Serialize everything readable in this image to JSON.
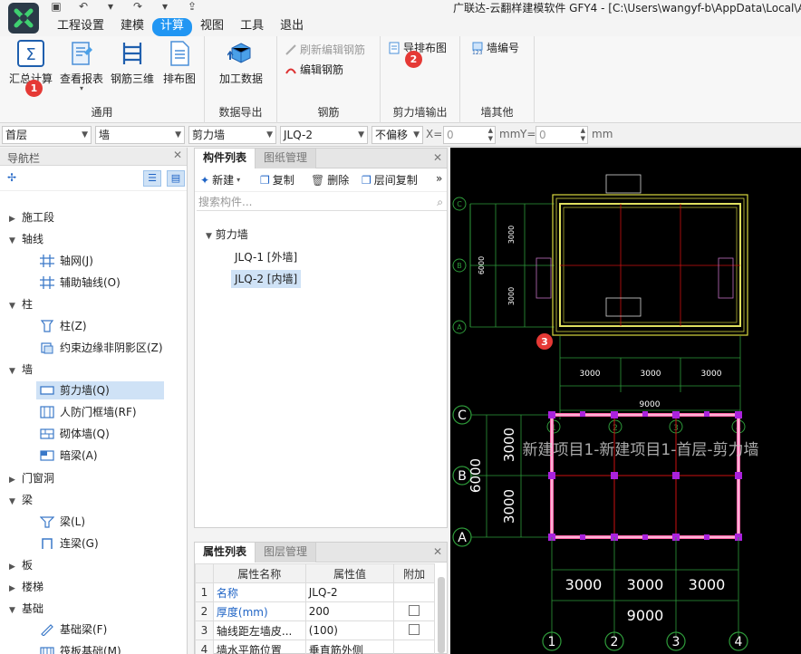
{
  "title_bar": {
    "window_title": "广联达-云翻样建模软件 GFY4 - [C:\\Users\\wangyf-b\\AppData\\Local\\A"
  },
  "menu": {
    "tabs": [
      {
        "label": "工程设置"
      },
      {
        "label": "建模"
      },
      {
        "label": "计算"
      },
      {
        "label": "视图"
      },
      {
        "label": "工具"
      },
      {
        "label": "退出"
      }
    ],
    "active": "计算"
  },
  "ribbon": {
    "groups": {
      "general": {
        "label": "通用",
        "buttons": [
          "汇总计算",
          "查看报表",
          "钢筋三维",
          "排布图"
        ]
      },
      "export": {
        "label": "数据导出",
        "buttons": [
          "加工数据"
        ]
      },
      "rebar": {
        "label": "钢筋",
        "buttons": [
          "刷新编辑钢筋",
          "编辑钢筋"
        ]
      },
      "wall_output": {
        "label": "剪力墙输出",
        "buttons": [
          "导排布图"
        ]
      },
      "wall_other": {
        "label": "墙其他",
        "buttons": [
          "墙编号"
        ]
      }
    },
    "badges": [
      "1",
      "2",
      "3"
    ]
  },
  "selectors": {
    "floor": "首层",
    "category": "墙",
    "type": "剪力墙",
    "component": "JLQ-2",
    "offset": "不偏移",
    "x_label": "X=",
    "x_value": "0",
    "x_unit": "mm",
    "y_label": "Y=",
    "y_value": "0",
    "y_unit": "mm"
  },
  "nav": {
    "title": "导航栏",
    "tree": [
      {
        "label": "施工段",
        "expanded": false
      },
      {
        "label": "轴线",
        "expanded": true,
        "children": [
          "轴网(J)",
          "辅助轴线(O)"
        ]
      },
      {
        "label": "柱",
        "expanded": true,
        "children": [
          "柱(Z)",
          "约束边缘非阴影区(Z)"
        ]
      },
      {
        "label": "墙",
        "expanded": true,
        "children": [
          "剪力墙(Q)",
          "人防门框墙(RF)",
          "砌体墙(Q)",
          "暗梁(A)"
        ]
      },
      {
        "label": "门窗洞",
        "expanded": false
      },
      {
        "label": "梁",
        "expanded": true,
        "children": [
          "梁(L)",
          "连梁(G)"
        ]
      },
      {
        "label": "板",
        "expanded": false
      },
      {
        "label": "楼梯",
        "expanded": false
      },
      {
        "label": "基础",
        "expanded": true,
        "children": [
          "基础梁(F)",
          "筏板基础(M)"
        ]
      }
    ],
    "selected": "剪力墙(Q)"
  },
  "component_panel": {
    "tabs": [
      "构件列表",
      "图纸管理"
    ],
    "toolbar": {
      "new": "新建",
      "copy": "复制",
      "delete": "删除",
      "floor_copy": "层间复制",
      "more": "»"
    },
    "search_placeholder": "搜索构件...",
    "tree_root": "剪力墙",
    "items": [
      "JLQ-1 [外墙]",
      "JLQ-2 [内墙]"
    ],
    "selected": "JLQ-2 [内墙]"
  },
  "property_panel": {
    "tabs": [
      "属性列表",
      "图层管理"
    ],
    "headers": [
      "属性名称",
      "属性值",
      "附加"
    ],
    "rows": [
      {
        "idx": "1",
        "name": "名称",
        "value": "JLQ-2",
        "checkbox": false
      },
      {
        "idx": "2",
        "name": "厚度(mm)",
        "value": "200",
        "checkbox": true
      },
      {
        "idx": "3",
        "name": "轴线距左墙皮...",
        "value": "(100)",
        "checkbox": true
      },
      {
        "idx": "4",
        "name": "墙水平筋位置",
        "value": "垂直筋外侧",
        "checkbox": false
      }
    ]
  },
  "canvas": {
    "overlay_text": "新建项目1-新建项目1-首层-剪力墙",
    "thumbnail": {
      "row_labels": [
        "C",
        "B",
        "A"
      ],
      "dims_h": [
        "3000",
        "3000",
        "3000"
      ],
      "total_h": "9000",
      "dims_v": [
        "3000",
        "3000"
      ],
      "total_v": "6000"
    },
    "plan": {
      "row_labels": [
        "C",
        "B",
        "A"
      ],
      "col_labels_top": [
        "1",
        "2",
        "3",
        "4"
      ],
      "col_labels_bottom": [
        "1",
        "2",
        "3",
        "4"
      ],
      "dims_h": [
        "3000",
        "3000",
        "3000"
      ],
      "total_h": "9000",
      "dims_v": [
        "3000",
        "3000"
      ],
      "total_v": "6000"
    },
    "colors": {
      "wall": "#ff66aa",
      "grid": "#cc1111",
      "node": "#aa22dd",
      "dim": "#ffffff",
      "axis": "#2e9a3a",
      "rebar": "#d8d840"
    }
  }
}
